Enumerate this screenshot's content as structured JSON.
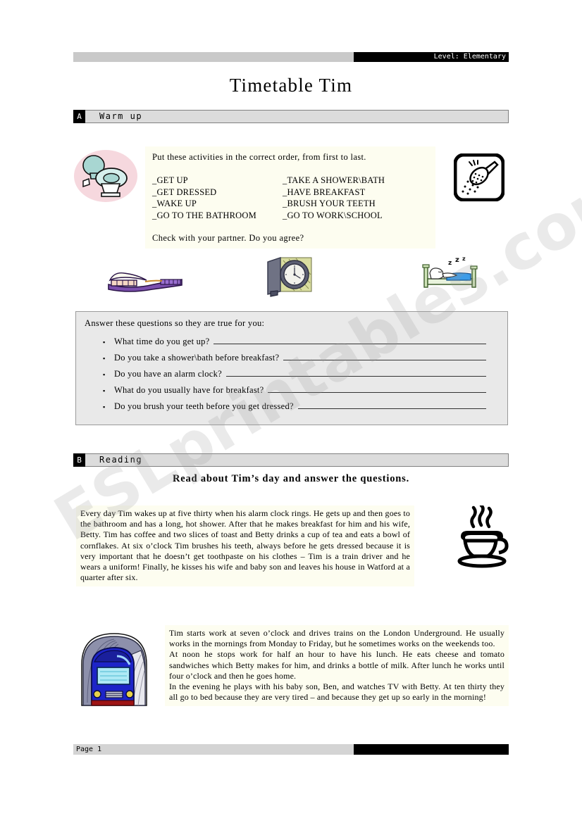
{
  "header": {
    "level_label": "Level: Elementary",
    "title": "Timetable Tim"
  },
  "sections": {
    "a": {
      "letter": "A",
      "label": "Warm up"
    },
    "b": {
      "letter": "B",
      "label": "Reading"
    }
  },
  "warmup": {
    "instruction": "Put these activities in the correct order, from first to last.",
    "activities_left": [
      "_GET UP",
      "_GET DRESSED",
      "_WAKE UP",
      "_GO TO THE BATHROOM"
    ],
    "activities_right": [
      "_TAKE A SHOWER\\BATH",
      "_HAVE BREAKFAST",
      "_BRUSH YOUR TEETH",
      "_GO TO WORK\\SCHOOL"
    ],
    "check_line": "Check with your partner.  Do you agree?"
  },
  "questions": {
    "intro": "Answer these questions so they are true for you:",
    "bullet": "▪",
    "items": [
      "What time do you get up?",
      "Do you take a shower\\bath before breakfast?",
      "Do you have an alarm clock?",
      "What do you usually have for breakfast?",
      "Do you brush your teeth before you get dressed?"
    ]
  },
  "reading": {
    "intro": "Read about Tim’s day and answer the questions.",
    "passage1": "Every day Tim wakes up at five thirty when his alarm clock rings. He gets up and then goes to the bathroom and has a long, hot shower. After that he makes breakfast for him and his wife, Betty. Tim has coffee and two slices of toast and Betty drinks a cup of tea and eats a bowl of cornflakes. At six o’clock Tim brushes his teeth, always before he gets dressed because it is very important that he doesn’t get toothpaste on his clothes – Tim is a train driver and he wears a uniform! Finally, he kisses his wife and baby son and leaves his house in Watford at a quarter after six.",
    "passage2_para1": "Tim starts work at seven o’clock and drives trains on the London Underground. He usually works in the mornings from Monday to Friday, but he sometimes works on the weekends too.",
    "passage2_para2": "At noon he stops work for half an hour to have his lunch. He eats cheese and tomato sandwiches which Betty makes for him, and drinks a bottle of milk. After lunch he works until four o’clock and then he goes home.",
    "passage2_para3": "In the evening he plays with his baby son, Ben, and watches TV with Betty. At ten thirty they all go to bed because they are very tired – and because they get up so early in the morning!"
  },
  "artwork": {
    "toilet": "toilet-icon",
    "shower": "shower-head-icon",
    "toothbrush": "toothbrush-icon",
    "clock": "alarm-clock-icon",
    "bed": "sleeping-in-bed-icon",
    "coffee": "coffee-cup-icon",
    "train": "train-in-tunnel-icon"
  },
  "footer": {
    "page_label": "Page 1"
  },
  "watermark": {
    "text": "ESLprintables.com"
  },
  "colors": {
    "banner_grey": "#c9c9c9",
    "banner_black": "#000000",
    "section_bar": "#dcdcdc",
    "question_box": "#e9e9e9",
    "passage_bg": "#fdfdf0",
    "toilet": "#bfe0dd",
    "toothbrush": "#7b4fae",
    "clock": "#cdd08a",
    "bed_blanket": "#3d9ce8",
    "train_body": "#1d24c8"
  }
}
